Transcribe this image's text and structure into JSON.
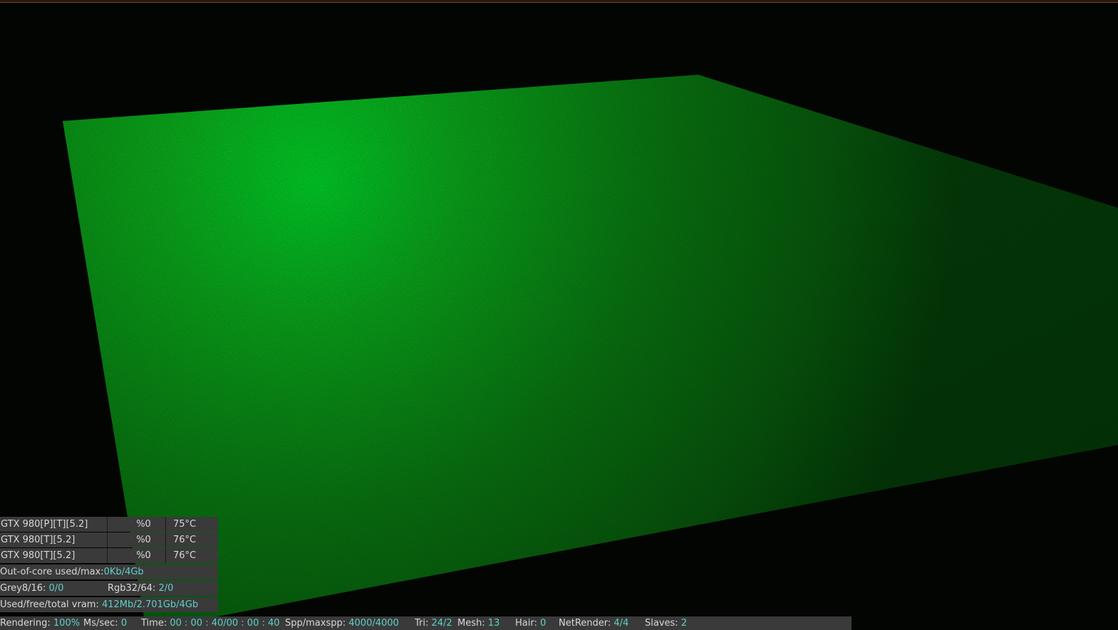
{
  "gpus": [
    {
      "name": "GTX 980[P][T][5.2]",
      "load": "%0",
      "temp": "75°C"
    },
    {
      "name": "GTX 980[T][5.2]",
      "load": "%0",
      "temp": "76°C"
    },
    {
      "name": "GTX 980[T][5.2]",
      "load": "%0",
      "temp": "76°C"
    }
  ],
  "memory": {
    "out_of_core_label": "Out-of-core used/max:",
    "out_of_core_value": "0Kb/4Gb",
    "grey_label": "Grey8/16: ",
    "grey_value": "0/0",
    "rgb_label": "Rgb32/64: ",
    "rgb_value": "2/0",
    "vram_label": "Used/free/total vram: ",
    "vram_value": "412Mb/2.701Gb/4Gb"
  },
  "status": {
    "rendering_label": "Rendering: ",
    "rendering_value": "100%",
    "mssec_label": "Ms/sec: ",
    "mssec_value": "0",
    "time_label": "Time: ",
    "time_value": "00 : 00 : 40/00 : 00 : 40",
    "spp_label": "Spp/maxspp: ",
    "spp_value": "4000/4000",
    "tri_label": "Tri: ",
    "tri_value": "24/2",
    "mesh_label": "Mesh: ",
    "mesh_value": "13",
    "hair_label": "Hair: ",
    "hair_value": "0",
    "netrender_label": "NetRender: ",
    "netrender_value": "4/4",
    "slaves_label": "Slaves: ",
    "slaves_value": "2"
  },
  "render_progress_percent": 100,
  "colors": {
    "plane_hot": "#00e82c",
    "plane_mid": "#0a9a14",
    "plane_dark": "#053d07",
    "background": "#030503",
    "value_text": "#5fd0c8",
    "panel_bg": "#3a3a3a"
  }
}
